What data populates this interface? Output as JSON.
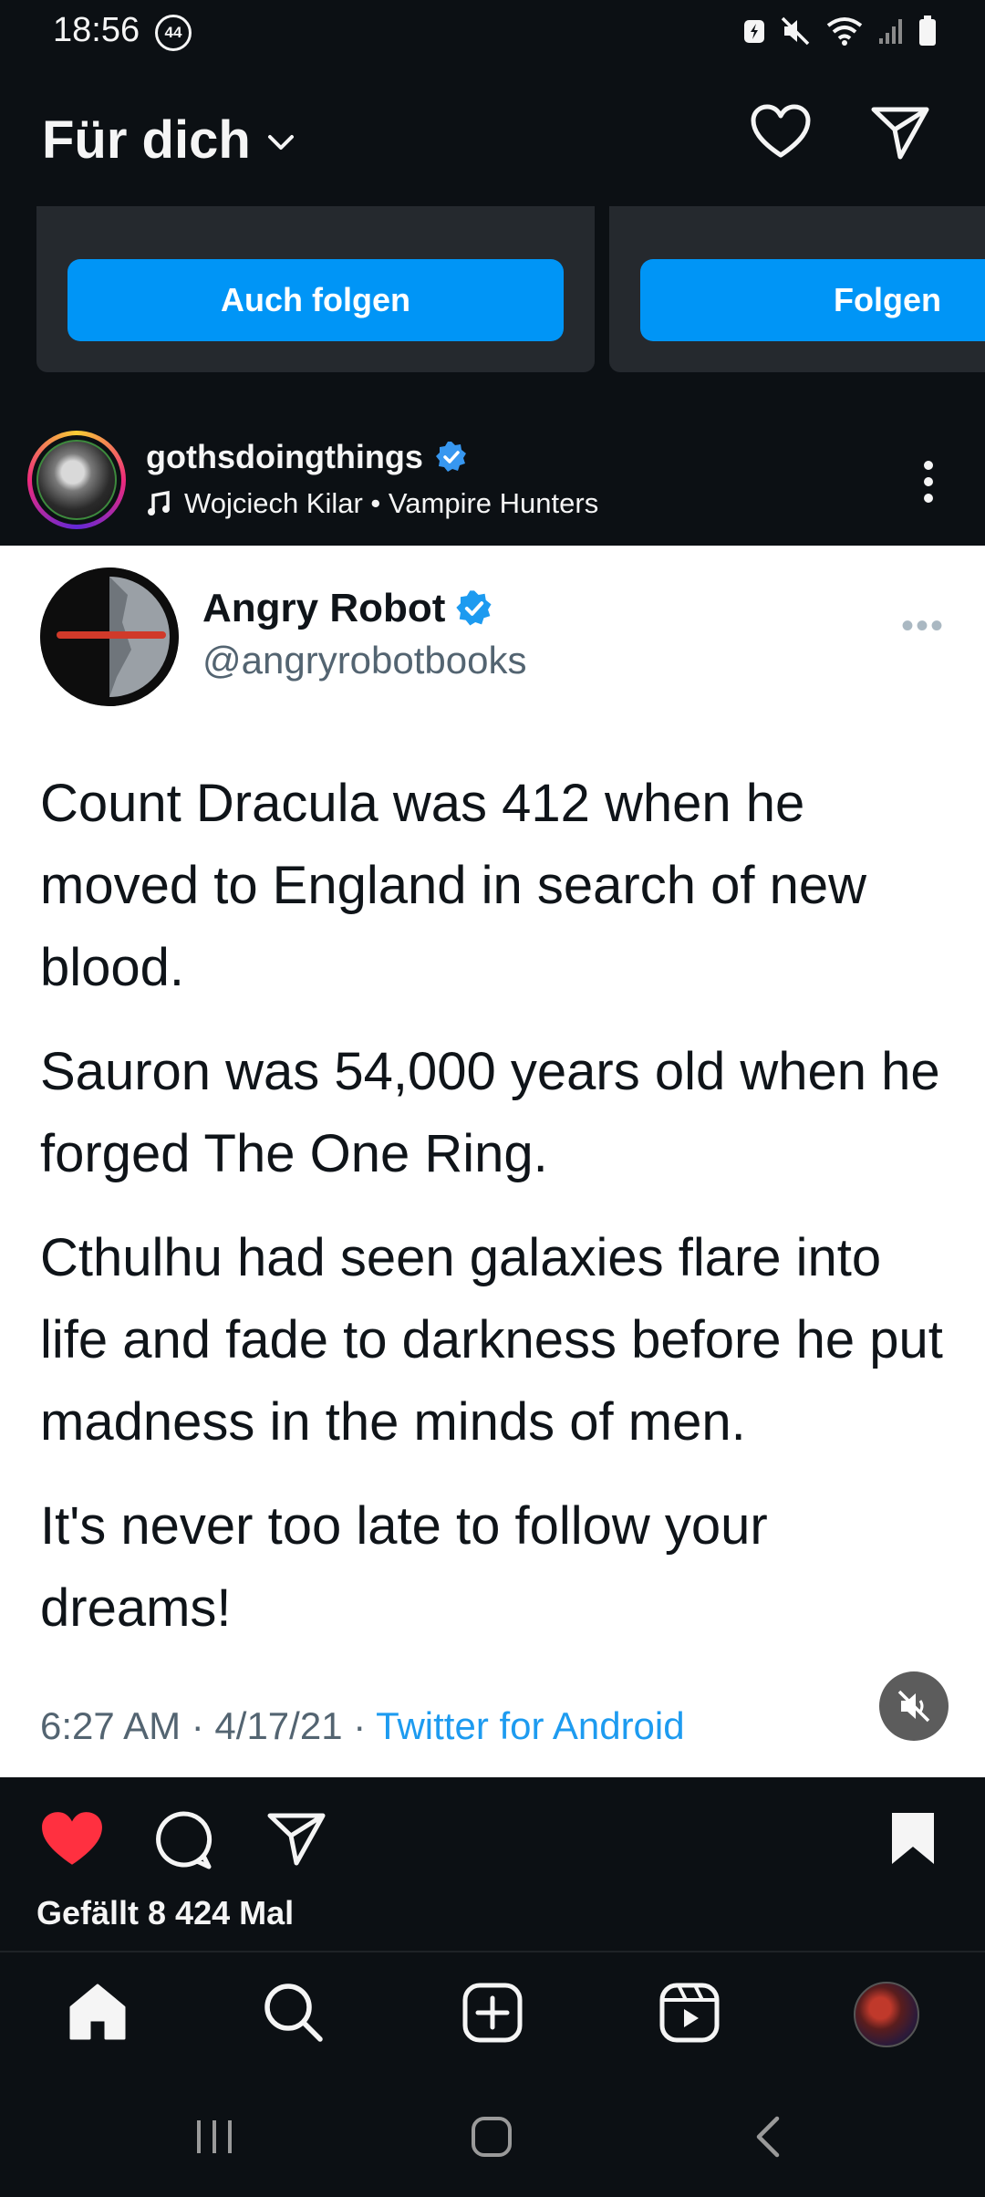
{
  "status_bar": {
    "time": "18:56",
    "notification_count": "44",
    "icons": [
      "battery-saver-icon",
      "mute-icon",
      "wifi-icon",
      "signal-icon",
      "battery-icon"
    ]
  },
  "header": {
    "title": "Für dich",
    "icons": [
      "chevron-down-icon",
      "heart-icon",
      "send-icon"
    ]
  },
  "suggestions": {
    "cards": [
      {
        "button_label": "Auch folgen"
      },
      {
        "button_label": "Folgen"
      }
    ]
  },
  "post": {
    "username": "gothsdoingthings",
    "verified": true,
    "audio": "Wojciech Kilar • Vampire Hunters",
    "tweet": {
      "name": "Angry Robot",
      "handle": "@angryrobotbooks",
      "paragraphs": [
        "Count Dracula was 412 when he moved to England in search of new blood.",
        "Sauron was 54,000 years old when he forged The One Ring.",
        "Cthulhu had seen galaxies flare into life and fade to darkness before he put madness in the minds of men.",
        "It's never too late to follow your dreams!"
      ],
      "timestamp": "6:27 AM · 4/17/21 · ",
      "source": "Twitter for Android"
    },
    "likes": "Gefällt 8 424 Mal",
    "liked": true
  },
  "bottom_nav": {
    "items": [
      "home-icon",
      "search-icon",
      "create-icon",
      "reels-icon",
      "profile-avatar"
    ]
  },
  "colors": {
    "background": "#0c1014",
    "accent": "#0095f6",
    "like": "#ff3040",
    "verified": "#3797f0"
  }
}
